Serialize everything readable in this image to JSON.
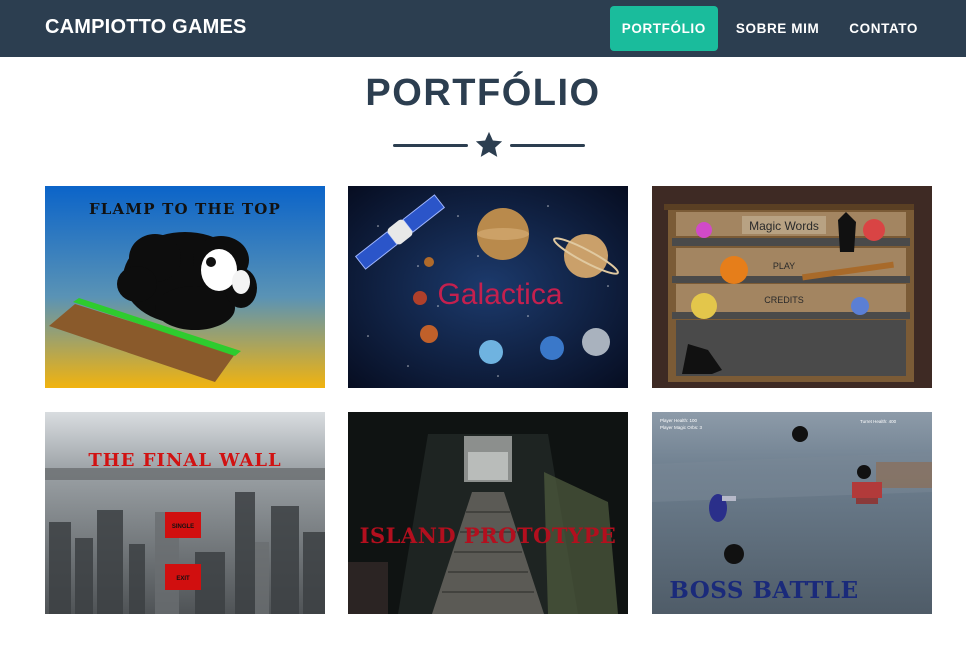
{
  "navbar": {
    "brand": "CAMPIOTTO GAMES",
    "items": [
      {
        "label": "PORTFÓLIO",
        "active": true
      },
      {
        "label": "SOBRE MIM",
        "active": false
      },
      {
        "label": "CONTATO",
        "active": false
      }
    ]
  },
  "section": {
    "title": "PORTFÓLIO",
    "divider_icon": "star-icon"
  },
  "portfolio": [
    {
      "title": "FLAMP TO THE TOP"
    },
    {
      "title": "Galactica"
    },
    {
      "title": "Magic Words",
      "menu": [
        "Magic Words",
        "PLAY",
        "CREDITS"
      ]
    },
    {
      "title": "THE FINAL WALL",
      "buttons": [
        "SINGLE",
        "EXIT"
      ]
    },
    {
      "title": "ISLAND PROTOTYPE"
    },
    {
      "title": "BOSS BATTLE",
      "hud": [
        "Player Health: 100",
        "Player Magic Orbs: 3",
        "Turret Health: 400"
      ]
    }
  ],
  "colors": {
    "navbar": "#2c3e50",
    "accent": "#1abc9c",
    "text": "#2c3e50"
  }
}
